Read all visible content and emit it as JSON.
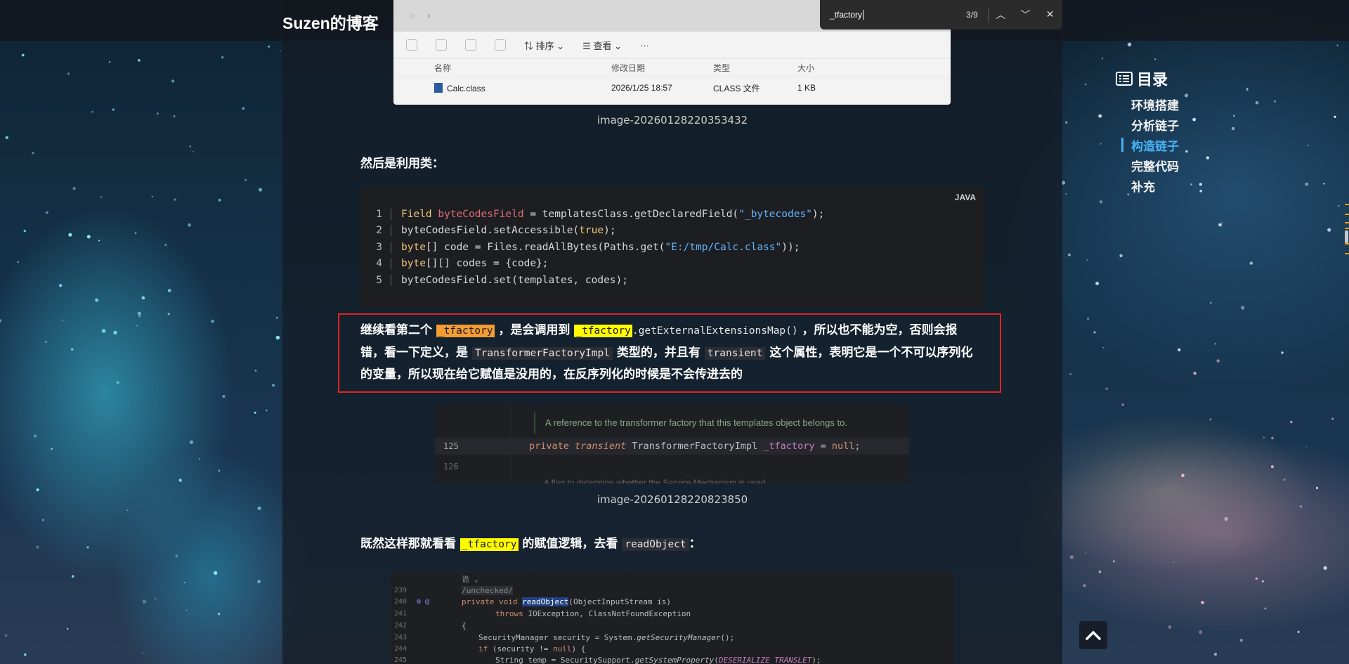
{
  "site": {
    "title": "Suzen的博客",
    "home_label": "首"
  },
  "explorer": {
    "toolbar": {
      "sort_label": "排序",
      "view_label": "查看",
      "more_label": "···"
    },
    "columns": {
      "name": "名称",
      "date": "修改日期",
      "type": "类型",
      "size": "大小"
    },
    "file": {
      "name": "Calc.class",
      "date": "2026/1/25 18:57",
      "type": "CLASS 文件",
      "size": "1 KB"
    }
  },
  "captions": {
    "img1": "image-20260128220353432",
    "img2": "image-20260128220823850"
  },
  "para_use_class": "然后是利用类：",
  "code": {
    "lang": "JAVA",
    "lines": [
      {
        "n": "1"
      },
      {
        "n": "2"
      },
      {
        "n": "3"
      },
      {
        "n": "4"
      },
      {
        "n": "5"
      }
    ]
  },
  "para3": {
    "t1": "继续看第二个",
    "m1": "_tfactory",
    "t2": "，是会调用到",
    "m2": "_tfactory",
    "c1": ".getExternalExtensionsMap()",
    "t3": "，所以也不能为空，否则会报错，看一下定义，是",
    "c2": "TransformerFactoryImpl",
    "t4": "类型的，并且有",
    "c3": "transient",
    "t5": "这个属性，表明它是一个不可以序列化的变量，所以现在给它赋值是没用的，在反序列化的时候是不会传进去的"
  },
  "ide1": {
    "doc": "A reference to the transformer factory that this templates object belongs to.",
    "line_125": "125",
    "line_126": "126",
    "code": "private transient TransformerFactoryImpl _tfactory = null;",
    "ghost": "A flag to determine whether the Service Mechanism is used"
  },
  "para4": {
    "t1": "既然这样那就看看",
    "m1": "_tfactory",
    "t2": "的赋值逻辑，去看",
    "c1": "readObject",
    "t3": "："
  },
  "ide2": {
    "hint": "诡 ⌄",
    "unchecked": "/unchecked/",
    "ln": [
      "239",
      "240",
      "241",
      "242",
      "243",
      "244",
      "245"
    ]
  },
  "toc": {
    "title": "目录",
    "items": [
      "环境搭建",
      "分析链子",
      "构造链子",
      "完整代码",
      "补充"
    ],
    "active_index": 2
  },
  "find": {
    "query": "_tfactory",
    "count": "3/9"
  },
  "colors": {
    "accent": "#49b1f5",
    "highlight_box": "#e02424",
    "mark_current": "#f39c34",
    "mark_other": "#fffb00"
  }
}
